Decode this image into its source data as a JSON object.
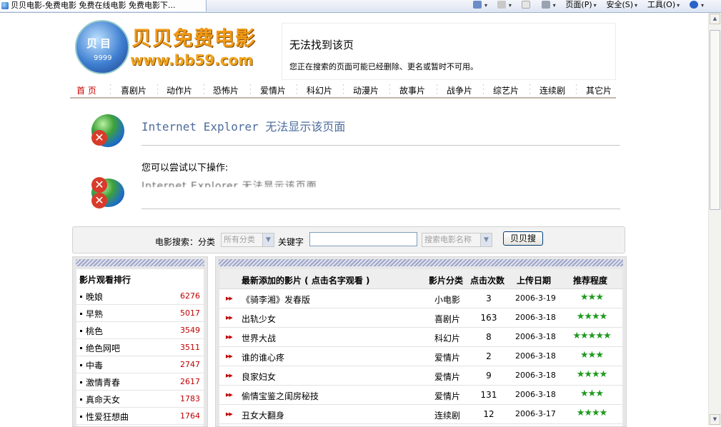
{
  "browser": {
    "tab_title": "贝贝电影-免费电影 免费在线电影 免费电影下...",
    "commands": [
      "页面(P)",
      "安全(S)",
      "工具(O)"
    ]
  },
  "logo": {
    "badge": "贝目",
    "badge_num": "9999",
    "title": "贝贝免费电影",
    "url": "www.bb59.com"
  },
  "header_error": {
    "title": "无法找到该页",
    "message": "您正在搜索的页面可能已经删除、更名或暂时不可用。"
  },
  "nav": [
    "首 页",
    "喜剧片",
    "动作片",
    "恐怖片",
    "爱情片",
    "科幻片",
    "动漫片",
    "故事片",
    "战争片",
    "综艺片",
    "连续剧",
    "其它片"
  ],
  "ie_error": {
    "title": "Internet Explorer 无法显示该页面",
    "try_text": "您可以尝试以下操作:",
    "ghost_text": "Internet Explorer 无法显示该页面"
  },
  "search": {
    "label": "电影搜索：分类",
    "category_value": "所有分类",
    "keyword_label": "关键字",
    "keyword_value": "",
    "field_value": "搜索电影名称",
    "button": "贝贝搜"
  },
  "ranking": {
    "title": "影片观看排行",
    "items": [
      {
        "name": "晚娘",
        "count": "6276"
      },
      {
        "name": "早熟",
        "count": "5017"
      },
      {
        "name": "桃色",
        "count": "3549"
      },
      {
        "name": "绝色网吧",
        "count": "3511"
      },
      {
        "name": "中毒",
        "count": "2747"
      },
      {
        "name": "激情青春",
        "count": "2617"
      },
      {
        "name": "真命天女",
        "count": "1783"
      },
      {
        "name": "性爱狂想曲",
        "count": "1764"
      }
    ]
  },
  "latest": {
    "headers": {
      "title": "最新添加的影片 ( 点击名字观看 )",
      "category": "影片分类",
      "clicks": "点击次数",
      "date": "上传日期",
      "rating": "推荐程度"
    },
    "rows": [
      {
        "title": "《骑李湘》发春版",
        "category": "小电影",
        "clicks": "3",
        "date": "2006-3-19",
        "stars": "★★★",
        "rating": 3
      },
      {
        "title": "出轨少女",
        "category": "喜剧片",
        "clicks": "163",
        "date": "2006-3-18",
        "stars": "★★★★",
        "rating": 4
      },
      {
        "title": "世界大战",
        "category": "科幻片",
        "clicks": "8",
        "date": "2006-3-18",
        "stars": "★★★★★",
        "rating": 5
      },
      {
        "title": "谁的谁心疼",
        "category": "爱情片",
        "clicks": "2",
        "date": "2006-3-18",
        "stars": "★★★",
        "rating": 3
      },
      {
        "title": "良家妇女",
        "category": "爱情片",
        "clicks": "9",
        "date": "2006-3-18",
        "stars": "★★★★",
        "rating": 4
      },
      {
        "title": "偷情宝鉴之闺房秘技",
        "category": "爱情片",
        "clicks": "131",
        "date": "2006-3-18",
        "stars": "★★★",
        "rating": 3
      },
      {
        "title": "丑女大翻身",
        "category": "连续剧",
        "clicks": "12",
        "date": "2006-3-17",
        "stars": "★★★★",
        "rating": 4
      }
    ]
  }
}
